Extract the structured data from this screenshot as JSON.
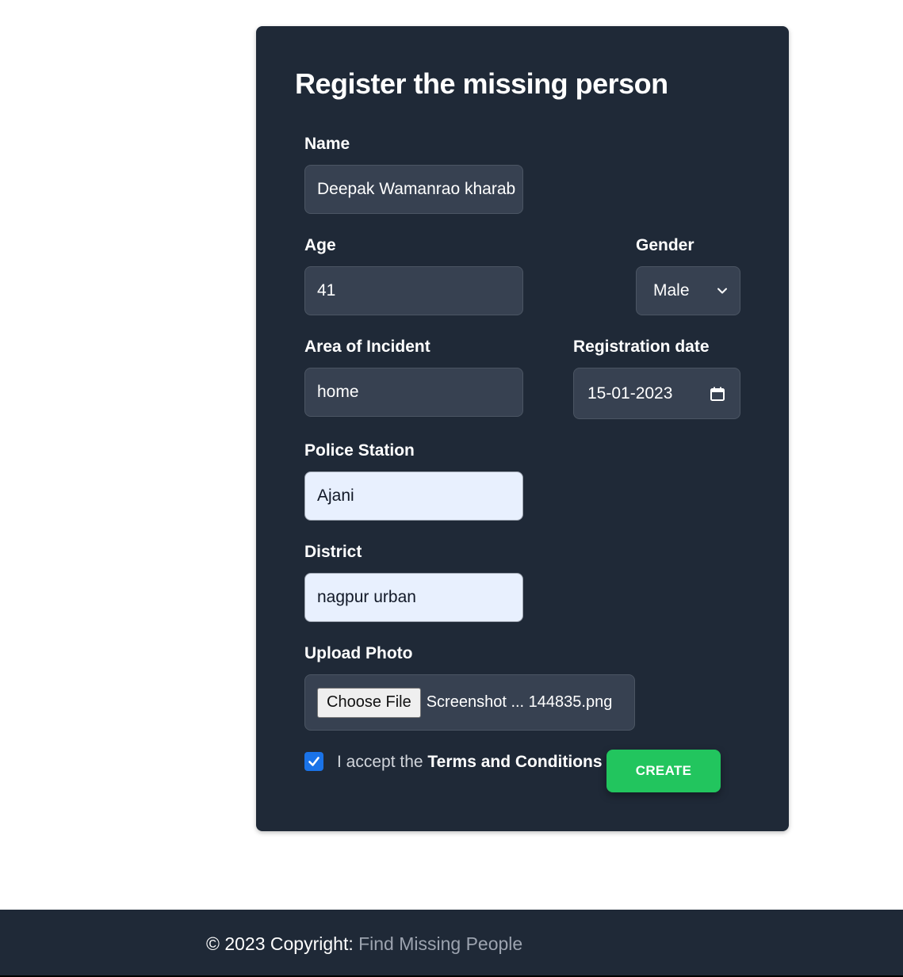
{
  "form": {
    "title": "Register the missing person",
    "name": {
      "label": "Name",
      "value": "Deepak Wamanrao kharab"
    },
    "age": {
      "label": "Age",
      "value": "41"
    },
    "gender": {
      "label": "Gender",
      "value": "Male"
    },
    "area": {
      "label": "Area of Incident",
      "value": "home"
    },
    "registration_date": {
      "label": "Registration date",
      "value": "15-01-2023"
    },
    "police_station": {
      "label": "Police Station",
      "value": "Ajani"
    },
    "district": {
      "label": "District",
      "value": "nagpur urban"
    },
    "upload": {
      "label": "Upload Photo",
      "button_label": "Choose File",
      "file_name": "Screenshot ... 144835.png"
    },
    "terms": {
      "prefix": "I accept the ",
      "link": "Terms and Conditions",
      "checked": true
    },
    "create_label": "CREATE"
  },
  "footer": {
    "text": "© 2023 Copyright: ",
    "link": "Find Missing People"
  },
  "colors": {
    "card_bg": "#1f2937",
    "input_bg": "#374151",
    "autofill_bg": "#e8f0fe",
    "create_button": "#22c55e",
    "checkbox": "#1a73e8"
  },
  "icons": {
    "gender_dropdown": "chevron-down-icon",
    "date_picker": "calendar-icon",
    "checkbox": "checkmark-icon"
  }
}
